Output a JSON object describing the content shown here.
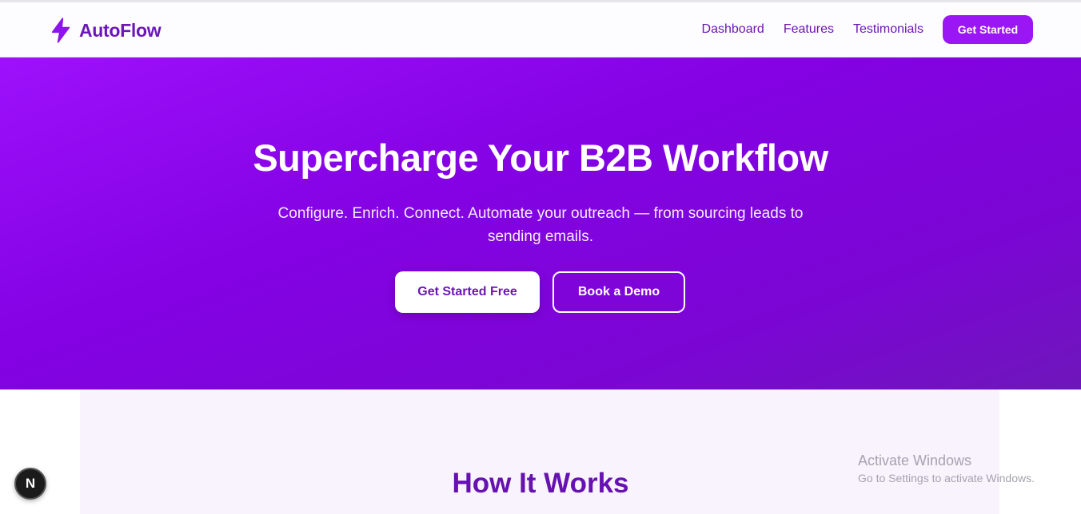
{
  "header": {
    "brand_name": "AutoFlow",
    "brand_icon": "lightning-bolt-icon",
    "nav": [
      "Dashboard",
      "Features",
      "Testimonials"
    ],
    "cta_label": "Get Started"
  },
  "hero": {
    "title": "Supercharge Your B2B Workflow",
    "subtitle": "Configure. Enrich. Connect. Automate your outreach — from sourcing leads to sending emails.",
    "primary_button": "Get Started Free",
    "secondary_button": "Book a Demo"
  },
  "how_it_works": {
    "title": "How It Works"
  },
  "overlay": {
    "activate_title": "Activate Windows",
    "activate_subtitle": "Go to Settings to activate Windows.",
    "dev_badge": "N"
  },
  "colors": {
    "brand_purple": "#6b16b4",
    "accent_purple": "#9b16f4",
    "hero_gradient_start": "#9d10fb",
    "hero_gradient_end": "#6e16bb",
    "section_bg": "#f8f3fd"
  }
}
